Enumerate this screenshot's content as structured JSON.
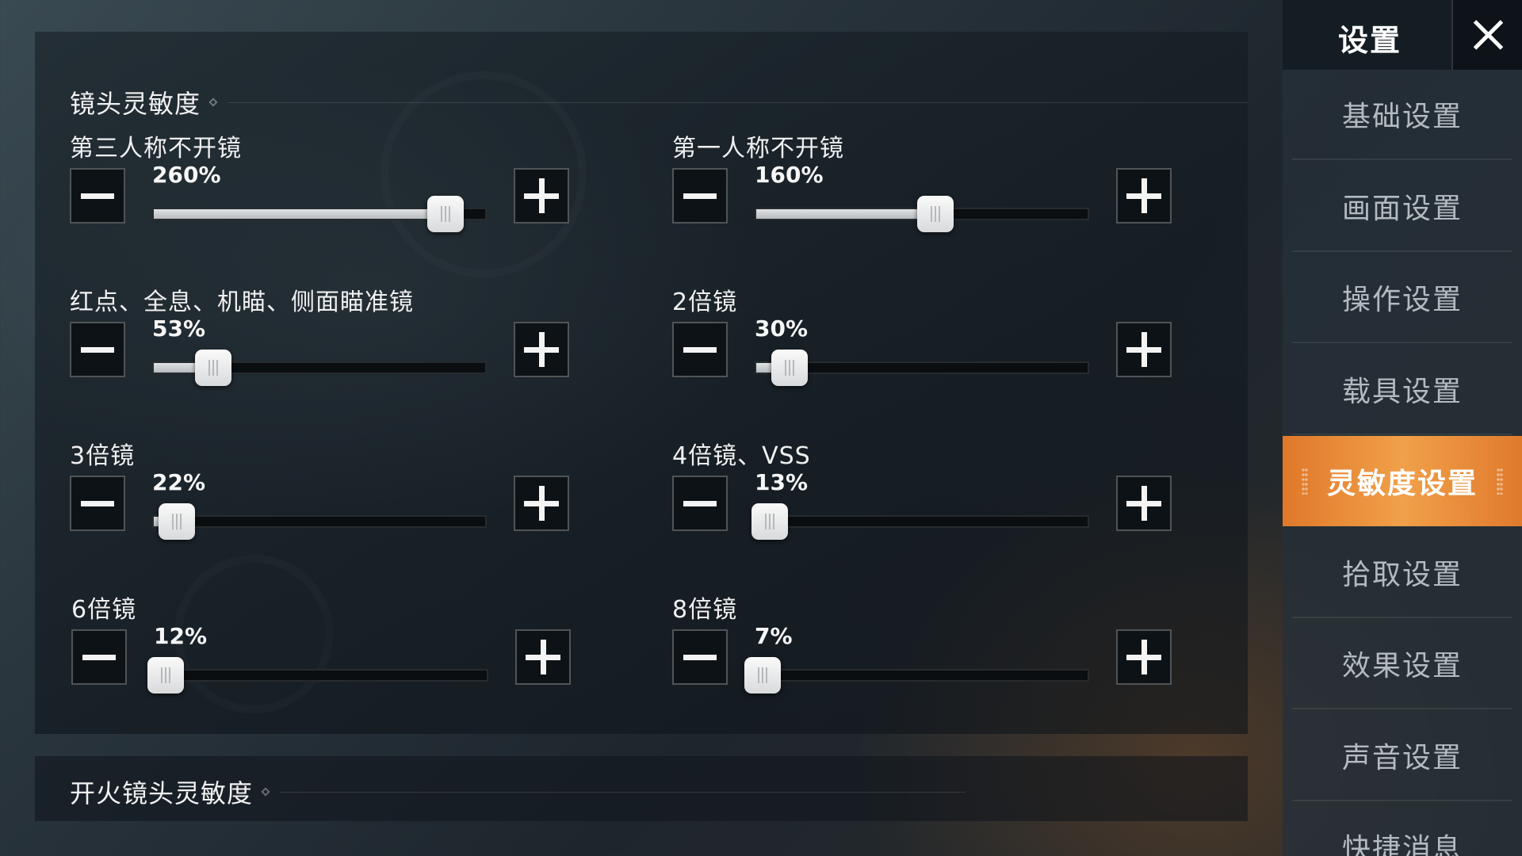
{
  "panel": {
    "section_title": "镜头灵敏度",
    "sub_section_title": "开火镜头灵敏度",
    "settings": [
      {
        "label": "第三人称不开镜",
        "value_text": "260%",
        "level": 0.88
      },
      {
        "label": "第一人称不开镜",
        "value_text": "160%",
        "level": 0.54
      },
      {
        "label": "红点、全息、机瞄、侧面瞄准镜",
        "value_text": "53%",
        "level": 0.18
      },
      {
        "label": "2倍镜",
        "value_text": "30%",
        "level": 0.1
      },
      {
        "label": "3倍镜",
        "value_text": "22%",
        "level": 0.07
      },
      {
        "label": "4倍镜、VSS",
        "value_text": "13%",
        "level": 0.04
      },
      {
        "label": "6倍镜",
        "value_text": "12%",
        "level": 0.03
      },
      {
        "label": "8倍镜",
        "value_text": "7%",
        "level": 0.02
      }
    ]
  },
  "sidebar": {
    "title": "设置",
    "items": [
      {
        "label": "基础设置",
        "active": false
      },
      {
        "label": "画面设置",
        "active": false
      },
      {
        "label": "操作设置",
        "active": false
      },
      {
        "label": "载具设置",
        "active": false
      },
      {
        "label": "灵敏度设置",
        "active": true
      },
      {
        "label": "拾取设置",
        "active": false
      },
      {
        "label": "效果设置",
        "active": false
      },
      {
        "label": "声音设置",
        "active": false
      },
      {
        "label": "快捷消息",
        "active": false
      }
    ]
  },
  "colors": {
    "accent": "#f1a04a",
    "panel_bg": "#141c22",
    "text": "#f0f0f0"
  },
  "icons": {
    "decrease": "minus-icon",
    "increase": "plus-icon",
    "close": "close-icon"
  }
}
